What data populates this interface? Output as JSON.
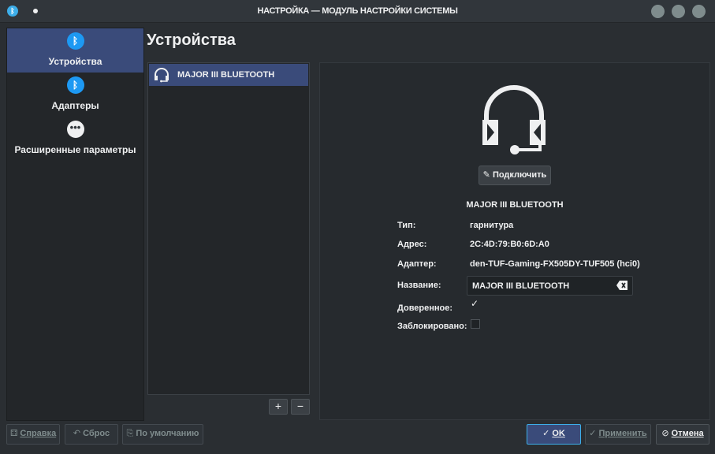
{
  "window": {
    "title": "НАСТРОЙКА — МОДУЛЬ НАСТРОЙКИ СИСТЕМЫ",
    "app_icon": "bluetooth-icon"
  },
  "sidebar": {
    "items": [
      {
        "label": "Устройства",
        "icon": "bluetooth-icon",
        "active": true
      },
      {
        "label": "Адаптеры",
        "icon": "bluetooth-icon",
        "active": false
      },
      {
        "label": "Расширенные параметры",
        "icon": "more-icon",
        "active": false
      }
    ]
  },
  "page": {
    "title": "Устройства"
  },
  "device_list": {
    "items": [
      {
        "name": "MAJOR III BLUETOOTH",
        "icon": "headset-icon"
      }
    ],
    "add_label": "+",
    "remove_label": "−"
  },
  "details": {
    "connect_label": "Подключить",
    "device_name": "MAJOR III BLUETOOTH",
    "type_label": "Тип:",
    "type_value": "гарнитура",
    "address_label": "Адрес:",
    "address_value": "2C:4D:79:B0:6D:A0",
    "adapter_label": "Адаптер:",
    "adapter_value": "den-TUF-Gaming-FX505DY-TUF505 (hci0)",
    "name_label": "Название:",
    "name_value": "MAJOR III BLUETOOTH",
    "trusted_label": "Доверенное:",
    "trusted": true,
    "blocked_label": "Заблокировано:",
    "blocked": false
  },
  "footer": {
    "help_label": "Справка",
    "reset_label": "Сброс",
    "defaults_label": "По умолчанию",
    "ok_label": "OK",
    "apply_label": "Применить",
    "cancel_label": "Отмена"
  },
  "colors": {
    "selection": "#3a4b7a",
    "accent": "#1d99f3",
    "background": "#2a2e32"
  }
}
